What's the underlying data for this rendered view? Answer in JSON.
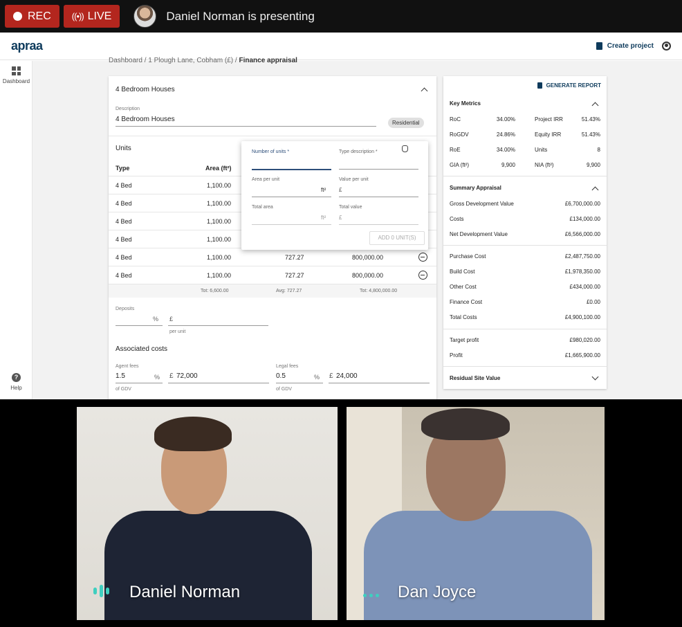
{
  "meeting": {
    "rec_label": "REC",
    "live_label": "LIVE",
    "presenting_text": "Daniel Norman is presenting"
  },
  "app": {
    "logo": "apraa",
    "create_project": "Create project",
    "nav_dashboard": "Dashboard",
    "nav_help": "Help",
    "breadcrumb": {
      "dashboard": "Dashboard",
      "project": "1 Plough Lane, Cobham (£)",
      "current": "Finance appraisal"
    }
  },
  "unit_group": {
    "title": "4 Bedroom Houses",
    "description_label": "Description",
    "description_value": "4 Bedroom Houses",
    "chip": "Residential",
    "units_heading": "Units",
    "columns": [
      "Type",
      "Area (ft²)"
    ],
    "rows": [
      {
        "type": "4 Bed",
        "area": "1,100.00",
        "rate": "",
        "value": ""
      },
      {
        "type": "4 Bed",
        "area": "1,100.00",
        "rate": "",
        "value": ""
      },
      {
        "type": "4 Bed",
        "area": "1,100.00",
        "rate": "",
        "value": ""
      },
      {
        "type": "4 Bed",
        "area": "1,100.00",
        "rate": "",
        "value": ""
      },
      {
        "type": "4 Bed",
        "area": "1,100.00",
        "rate": "727.27",
        "value": "800,000.00"
      },
      {
        "type": "4 Bed",
        "area": "1,100.00",
        "rate": "727.27",
        "value": "800,000.00"
      }
    ],
    "totals": {
      "area": "Tot: 6,600.00",
      "rate": "Avg: 727.27",
      "value": "Tot: 4,800,000.00"
    },
    "deposits_label": "Deposits",
    "deposits_pct_unit": "%",
    "deposits_currency": "£",
    "per_unit": "per unit",
    "assoc_heading": "Associated costs",
    "agent_fees_label": "Agent fees",
    "agent_fees_pct": "1.5",
    "agent_fees_amount": "72,000",
    "legal_fees_label": "Legal fees",
    "legal_fees_pct": "0.5",
    "legal_fees_amount": "24,000",
    "of_gdv": "of GDV",
    "pct": "%",
    "gbp": "£"
  },
  "popover": {
    "num_units_label": "Number of units *",
    "type_desc_label": "Type description *",
    "area_per_unit_label": "Area per unit",
    "area_unit": "ft²",
    "value_per_unit_label": "Value per unit",
    "currency": "£",
    "total_area_label": "Total area",
    "total_value_label": "Total value",
    "add_button": "ADD 0 UNIT(S)"
  },
  "side": {
    "generate_report": "GENERATE REPORT",
    "key_metrics_title": "Key Metrics",
    "key_metrics": [
      {
        "l1": "RoC",
        "v1": "34.00%",
        "l2": "Project IRR",
        "v2": "51.43%"
      },
      {
        "l1": "RoGDV",
        "v1": "24.86%",
        "l2": "Equity IRR",
        "v2": "51.43%"
      },
      {
        "l1": "RoE",
        "v1": "34.00%",
        "l2": "Units",
        "v2": "8"
      },
      {
        "l1": "GIA (ft²)",
        "v1": "9,900",
        "l2": "NIA (ft²)",
        "v2": "9,900"
      }
    ],
    "summary_title": "Summary Appraisal",
    "summary_a": [
      {
        "label": "Gross Development Value",
        "value": "£6,700,000.00"
      },
      {
        "label": "Costs",
        "value": "£134,000.00"
      },
      {
        "label": "Net Development Value",
        "value": "£6,566,000.00"
      }
    ],
    "summary_b": [
      {
        "label": "Purchase Cost",
        "value": "£2,487,750.00"
      },
      {
        "label": "Build Cost",
        "value": "£1,978,350.00"
      },
      {
        "label": "Other Cost",
        "value": "£434,000.00"
      },
      {
        "label": "Finance Cost",
        "value": "£0.00"
      },
      {
        "label": "Total Costs",
        "value": "£4,900,100.00"
      }
    ],
    "summary_c": [
      {
        "label": "Target profit",
        "value": "£980,020.00"
      },
      {
        "label": "Profit",
        "value": "£1,665,900.00"
      }
    ],
    "residual_title": "Residual Site Value"
  },
  "participants": [
    {
      "name": "Daniel Norman"
    },
    {
      "name": "Dan Joyce"
    }
  ]
}
